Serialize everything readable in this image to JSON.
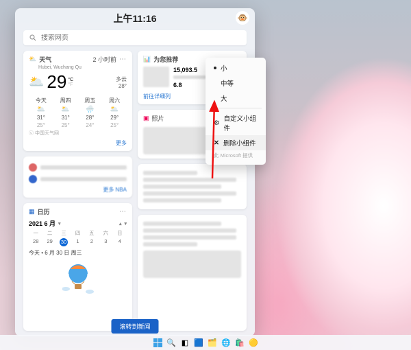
{
  "time": "上午11:16",
  "avatar_emoji": "🐵",
  "search": {
    "placeholder": "搜索网页"
  },
  "weather": {
    "title": "天气",
    "ago": "2 小时前",
    "location": "Hubei, Wuchang Qu",
    "temp": "29",
    "unit_top": "°C",
    "unit_bot": "°F",
    "cond": "多云",
    "cond2": "28°",
    "days": {
      "labels": [
        "今天",
        "周四",
        "周五",
        "周六"
      ],
      "hi": [
        "31°",
        "31°",
        "28°",
        "29°"
      ],
      "lo": [
        "25°",
        "25°",
        "24°",
        "25°"
      ]
    },
    "src": "中国天气网",
    "more": "更多"
  },
  "sports": {
    "more": "更多 NBA"
  },
  "calendar": {
    "title": "日历",
    "month": "2021 6 月",
    "dow": [
      "一",
      "二",
      "三",
      "四",
      "五",
      "六",
      "日"
    ],
    "row": [
      "28",
      "29",
      "30",
      "1",
      "2",
      "3",
      "4"
    ],
    "today_idx": 2,
    "today_line": "今天 • 6 月 30 日 周三"
  },
  "recommend": {
    "title": "为您推荐",
    "value1": "15,093.5",
    "value2": "6.8",
    "link": "前往详细列"
  },
  "photos": {
    "title": "照片"
  },
  "scroll_label": "滚转到新闻",
  "ctx": {
    "small": "小",
    "medium": "中等",
    "large": "大",
    "custom": "自定义小组件",
    "remove": "删除小组件",
    "hint": "此 Microsoft 提供"
  },
  "taskbar_icons": [
    "start",
    "search",
    "taskview",
    "widgets",
    "explorer",
    "edge",
    "store",
    "chrome"
  ]
}
